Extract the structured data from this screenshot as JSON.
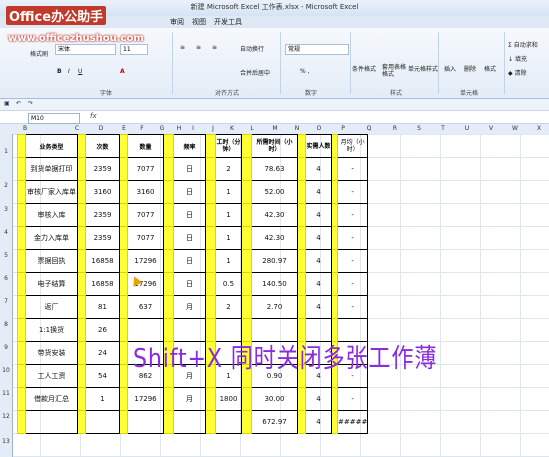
{
  "window": {
    "title": "新建 Microsoft Excel 工作表.xlsx - Microsoft Excel"
  },
  "logo": {
    "brand": "Office办公助手",
    "url": "www.officezhushou.com"
  },
  "ribbon_tabs": [
    "审阅",
    "视图",
    "开发工具"
  ],
  "ribbon": {
    "font_name": "宋体",
    "font_size": "11",
    "wrap_text": "自动换行",
    "merge_center": "合并后居中",
    "number_format": "常规",
    "cond_format": "条件格式",
    "table_format": "套用表格格式",
    "cell_style": "单元格样式",
    "insert": "插入",
    "delete": "删除",
    "format": "格式",
    "autosum": "自动求和",
    "fill": "填充",
    "clear": "清除",
    "paste_format": "格式刷",
    "groups": [
      "字体",
      "对齐方式",
      "数字",
      "样式",
      "单元格"
    ]
  },
  "formula_bar": {
    "name_box": "M10",
    "fx": "fx"
  },
  "columns": [
    "B",
    "C",
    "D",
    "E",
    "F",
    "G",
    "H",
    "I",
    "J",
    "K",
    "L",
    "M",
    "N",
    "O",
    "P",
    "Q",
    "R",
    "S",
    "T",
    "U",
    "V",
    "W",
    "X"
  ],
  "row_numbers": [
    "1",
    "2",
    "3",
    "4",
    "5",
    "6",
    "7",
    "8",
    "9",
    "10",
    "11",
    "12",
    "13"
  ],
  "headers": [
    "业务类型",
    "次数",
    "数量",
    "频率",
    "工时（分钟）",
    "所需时间（小时）",
    "实需人数",
    "月均（小时）"
  ],
  "rows": [
    [
      "到货单据打印",
      "2359",
      "7077",
      "日",
      "2",
      "78.63",
      "4",
      "-"
    ],
    [
      "审核厂家入库单",
      "3160",
      "3160",
      "日",
      "1",
      "52.00",
      "4",
      "-"
    ],
    [
      "审核入库",
      "2359",
      "7077",
      "日",
      "1",
      "42.30",
      "4",
      "-"
    ],
    [
      "金力入库单",
      "2359",
      "7077",
      "日",
      "1",
      "42.30",
      "4",
      "-"
    ],
    [
      "票据回执",
      "16858",
      "17296",
      "日",
      "1",
      "280.97",
      "4",
      "-"
    ],
    [
      "电子结算",
      "16858",
      "17296",
      "日",
      "0.5",
      "140.50",
      "4",
      "-"
    ],
    [
      "返厂",
      "81",
      "637",
      "月",
      "2",
      "2.70",
      "4",
      "-"
    ],
    [
      "1:1换货",
      "26",
      "",
      "",
      "",
      "",
      "",
      ""
    ],
    [
      "带货安装",
      "24",
      "",
      "",
      "",
      "",
      "",
      ""
    ],
    [
      "工人工资",
      "54",
      "862",
      "月",
      "1",
      "0.90",
      "4",
      "-"
    ],
    [
      "借款月汇总",
      "1",
      "17296",
      "月",
      "1800",
      "30.00",
      "4",
      "-"
    ],
    [
      "",
      "",
      "",
      "",
      "",
      "672.97",
      "4",
      "#####"
    ]
  ],
  "overlay_caption": "Shift+X 同时关闭多张工作薄"
}
